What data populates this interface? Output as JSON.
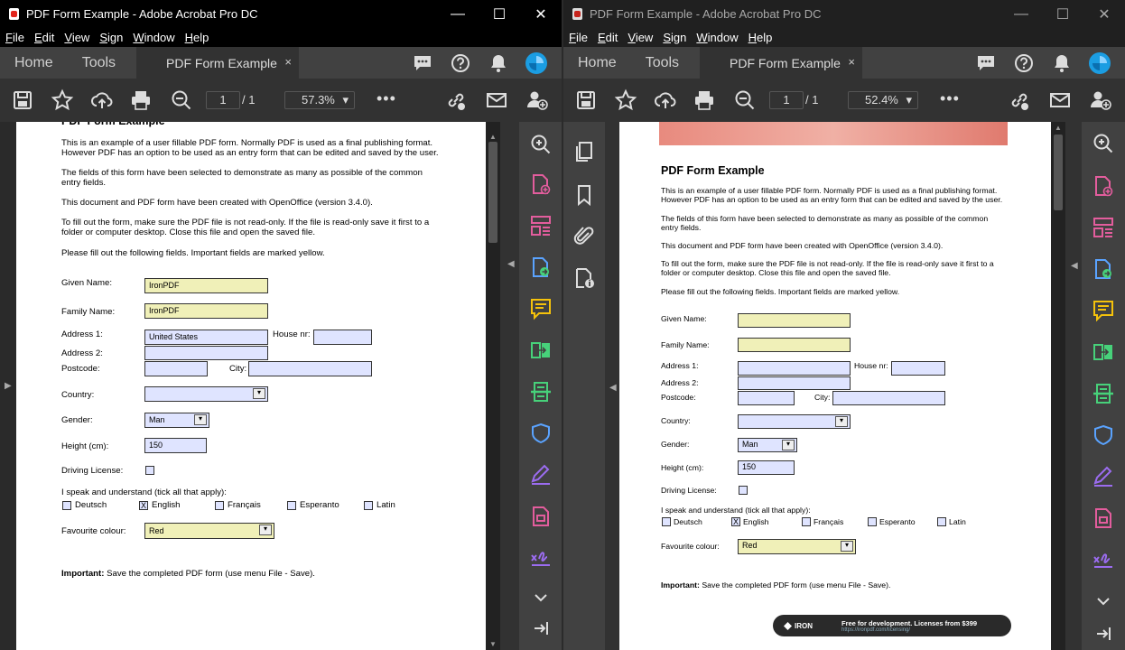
{
  "window": {
    "title": "PDF Form Example - Adobe Acrobat Pro DC",
    "controls": [
      "—",
      "☐",
      "✕"
    ]
  },
  "menu": [
    "File",
    "Edit",
    "View",
    "Sign",
    "Window",
    "Help"
  ],
  "tabs": {
    "home": "Home",
    "tools": "Tools",
    "doc": "PDF Form Example",
    "close": "×"
  },
  "left_view": {
    "page_current": "1",
    "page_total": "/ 1",
    "zoom": "57.3%"
  },
  "right_view": {
    "page_current": "1",
    "page_total": "/ 1",
    "zoom": "52.4%"
  },
  "colors": {
    "tool_green": "#47d17a",
    "tool_pink": "#e35d9d",
    "tool_purple": "#9b6cf0",
    "tool_yellow": "#f5c20b",
    "tool_blue": "#5aa3ff",
    "sign_blue": "#1b9de2"
  },
  "form": {
    "heading": "PDF Form Example",
    "intro1a": "This is an example of a user fillable PDF form. Normally PDF is used as a final publishing format.",
    "intro1b": "However PDF has an option to be used as an entry form that can be edited and saved by the user.",
    "intro2a": "The fields of this form have been selected to demonstrate as many as possible of the common",
    "intro2b": "entry fields.",
    "intro3": "This document and PDF form have been created with OpenOffice (version 3.4.0).",
    "intro4a": "To fill out the form, make sure the PDF file is not read-only. If the file is read-only save it first to a",
    "intro4b": "folder or computer desktop. Close this file and open the saved file.",
    "intro5": "Please fill out the following fields. Important fields are marked yellow.",
    "given_name_label": "Given Name:",
    "family_name_label": "Family Name:",
    "address1_label": "Address 1:",
    "house_label": "House nr:",
    "address2_label": "Address 2:",
    "postcode_label": "Postcode:",
    "city_label": "City:",
    "country_label": "Country:",
    "gender_label": "Gender:",
    "height_label": "Height (cm):",
    "driving_label": "Driving License:",
    "speak_label": "I speak and understand (tick all that apply):",
    "lang_deutsch": "Deutsch",
    "lang_english": "English",
    "lang_francais": "Français",
    "lang_esperanto": "Esperanto",
    "lang_latin": "Latin",
    "colour_label": "Favourite colour:",
    "important_bold": "Important:",
    "important_rest": " Save the completed PDF form (use menu File - Save).",
    "check_mark": "X"
  },
  "left_values": {
    "given_name": "IronPDF",
    "family_name": "IronPDF",
    "address1": "United States",
    "gender": "Man",
    "height": "150",
    "colour": "Red"
  },
  "right_values": {
    "given_name": "",
    "family_name": "",
    "address1": "",
    "gender": "Man",
    "height": "150",
    "colour": "Red"
  },
  "iron_banner": {
    "logo": "IRON",
    "message": "Free for development. Licenses from $399",
    "link": "https://ironpdf.com/licensing/"
  }
}
